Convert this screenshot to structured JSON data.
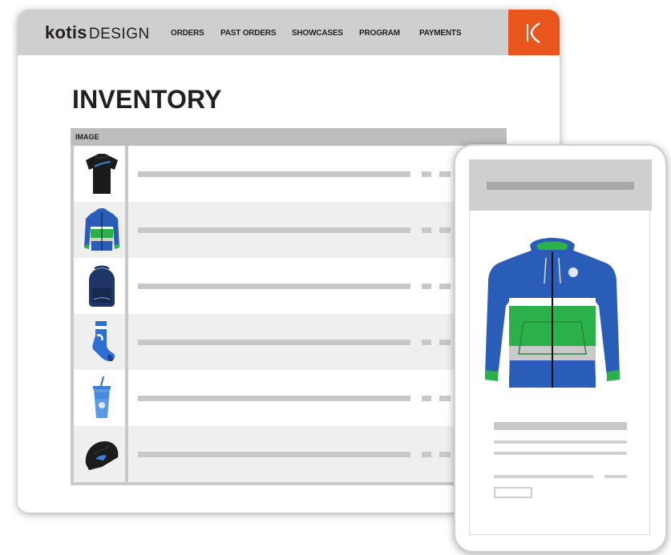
{
  "header": {
    "logo_bold": "kotis",
    "logo_light": "DESIGN",
    "nav": [
      {
        "label": "ORDERS"
      },
      {
        "label": "PAST ORDERS"
      },
      {
        "label": "SHOWCASES"
      },
      {
        "label": "PROGRAM"
      },
      {
        "label": "PAYMENTS"
      }
    ],
    "badge_icon": "kotis-k-icon"
  },
  "page": {
    "title": "INVENTORY"
  },
  "table": {
    "columns": [
      "IMAGE"
    ],
    "rows": [
      {
        "product_icon": "tshirt-icon"
      },
      {
        "product_icon": "hoodie-icon"
      },
      {
        "product_icon": "backpack-icon"
      },
      {
        "product_icon": "sock-icon"
      },
      {
        "product_icon": "tumbler-icon"
      },
      {
        "product_icon": "beanie-icon"
      }
    ]
  },
  "mobile": {
    "product_icon": "hoodie-icon"
  },
  "colors": {
    "accent": "#e8551d",
    "nav_bg": "#cfcfcf",
    "product_blue": "#2a5db8",
    "product_green": "#2bb04a"
  }
}
